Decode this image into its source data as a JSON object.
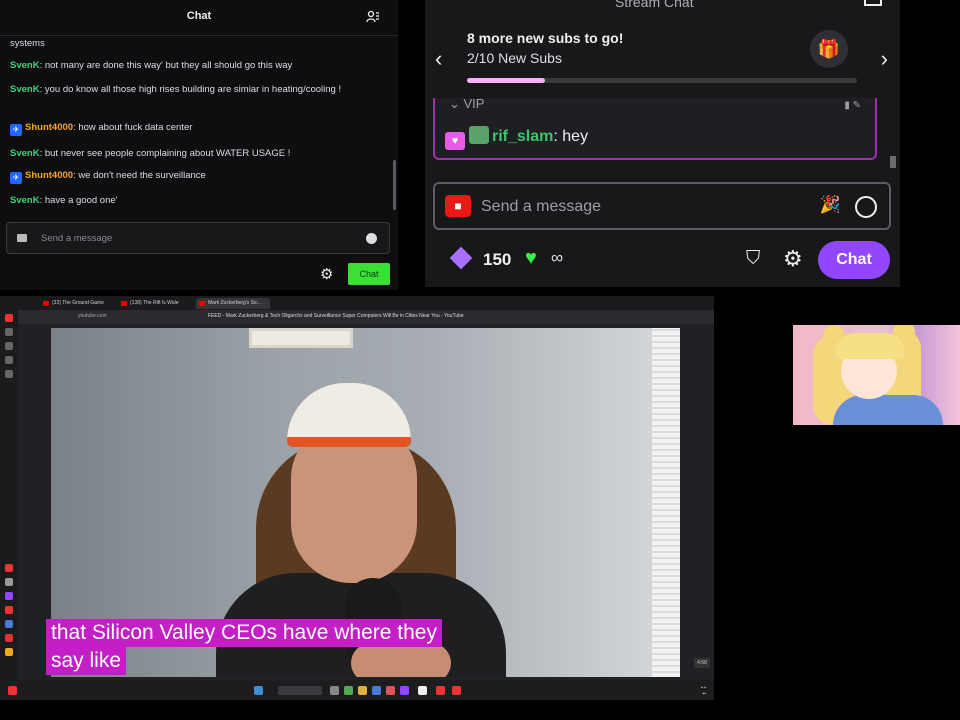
{
  "left_chat": {
    "title": "Chat",
    "messages": [
      {
        "user": "",
        "text": "systems"
      },
      {
        "user": "SvenK",
        "text": ": not many are done this way' but they all should go this way"
      },
      {
        "user": "SvenK",
        "text": ": you do know all those high rises building are simiar in heating/cooling !"
      },
      {
        "user": "Shunt4000",
        "text": ": how about fuck data center"
      },
      {
        "user": "SvenK",
        "text": ": but never see people complaining about WATER USAGE !"
      },
      {
        "user": "Shunt4000",
        "text": ": we don't need the surveillance"
      },
      {
        "user": "SvenK",
        "text": ": have a good one'"
      }
    ],
    "input_placeholder": "Send a message",
    "chat_button": "Chat"
  },
  "right_chat": {
    "title": "Stream Chat",
    "goal": {
      "headline": "8 more new subs to go!",
      "progress_text": "2/10 New Subs",
      "progress_fraction": 0.2
    },
    "vip_label": "VIP",
    "vip_message": {
      "user": "rif_slam",
      "text": ": hey"
    },
    "input_placeholder": "Send a message",
    "points": "150",
    "infinity": "∞",
    "chat_button": "Chat",
    "colors": {
      "accent": "#9147ff",
      "vip_border": "#a12eb0",
      "goal_fill": "#f5b2f5"
    }
  },
  "browser": {
    "tabs": [
      "(33) The Ground Game",
      "(138) The Rift Is Wide",
      "Mark Zuckerberg's Se..."
    ],
    "url": "youtube.com",
    "page_title": "FEED - Mark Zuckerberg & Tech Oligarchs and Surveillance Super Computers Will Be in Cities Near You - YouTube",
    "captions": [
      "that Silicon Valley CEOs have where they",
      "say like"
    ],
    "video_badge": "4:58"
  }
}
